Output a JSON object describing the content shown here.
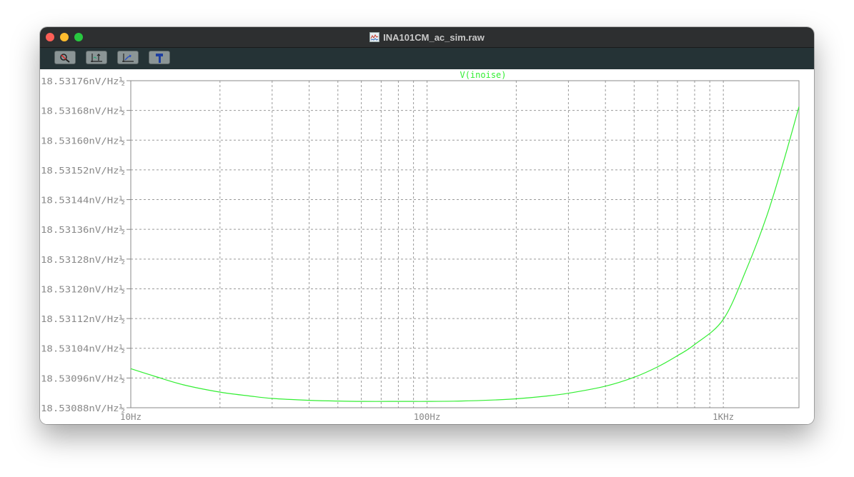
{
  "window": {
    "title": "INA101CM_ac_sim.raw"
  },
  "toolbar": {
    "buttons": [
      {
        "icon": "zoom-icon"
      },
      {
        "icon": "autorange-icon"
      },
      {
        "icon": "pan-icon"
      },
      {
        "icon": "hammer-icon"
      }
    ]
  },
  "colors": {
    "trace": "#33ee33",
    "grid": "#999999",
    "axis_text": "#888888",
    "titlebar": "#2d2f30",
    "toolbar": "#253336"
  },
  "chart_data": {
    "type": "line",
    "trace_label": "V(inoise)",
    "x_scale": "log",
    "xlim": [
      10,
      1800
    ],
    "ylim": [
      18.53088,
      18.53176
    ],
    "y_unit": "nV/Hz½",
    "x_ticks": [
      {
        "value": 10,
        "label": "10Hz"
      },
      {
        "value": 100,
        "label": "100Hz"
      },
      {
        "value": 1000,
        "label": "1KHz"
      }
    ],
    "y_ticks": [
      {
        "value": 18.53176,
        "label": "18.53176nV/Hz½"
      },
      {
        "value": 18.53168,
        "label": "18.53168nV/Hz½"
      },
      {
        "value": 18.5316,
        "label": "18.53160nV/Hz½"
      },
      {
        "value": 18.53152,
        "label": "18.53152nV/Hz½"
      },
      {
        "value": 18.53144,
        "label": "18.53144nV/Hz½"
      },
      {
        "value": 18.53136,
        "label": "18.53136nV/Hz½"
      },
      {
        "value": 18.53128,
        "label": "18.53128nV/Hz½"
      },
      {
        "value": 18.5312,
        "label": "18.53120nV/Hz½"
      },
      {
        "value": 18.53112,
        "label": "18.53112nV/Hz½"
      },
      {
        "value": 18.53104,
        "label": "18.53104nV/Hz½"
      },
      {
        "value": 18.53096,
        "label": "18.53096nV/Hz½"
      },
      {
        "value": 18.53088,
        "label": "18.53088nV/Hz½"
      }
    ],
    "grid": true,
    "series": [
      {
        "name": "V(inoise)",
        "x": [
          10,
          12,
          15,
          20,
          25,
          30,
          40,
          50,
          60,
          75,
          90,
          100,
          130,
          170,
          200,
          250,
          300,
          400,
          500,
          600,
          700,
          800,
          1000,
          1200,
          1400,
          1600,
          1800
        ],
        "y": [
          18.530985,
          18.530965,
          18.530942,
          18.530922,
          18.530912,
          18.530905,
          18.5309,
          18.530898,
          18.530897,
          18.530897,
          18.530897,
          18.530897,
          18.530898,
          18.530901,
          18.530904,
          18.530911,
          18.530919,
          18.530938,
          18.530962,
          18.53099,
          18.53102,
          18.53105,
          18.531118,
          18.531255,
          18.531395,
          18.531545,
          18.53169
        ]
      }
    ]
  }
}
